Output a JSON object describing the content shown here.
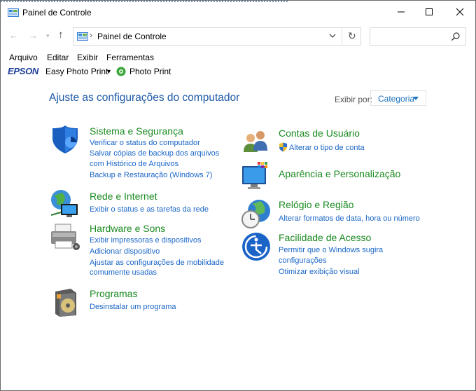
{
  "window": {
    "title": "Painel de Controle"
  },
  "address": {
    "path": "Painel de Controle",
    "search_placeholder": ""
  },
  "menu": [
    "Arquivo",
    "Editar",
    "Exibir",
    "Ferramentas"
  ],
  "epson": {
    "logo": "EPSON",
    "easy_photo_print": "Easy Photo Print",
    "photo_print": "Photo Print"
  },
  "main": {
    "title": "Ajuste as configurações do computador",
    "view_by_label": "Exibir por:",
    "view_by_value": "Categoria"
  },
  "categories": {
    "system": {
      "title": "Sistema e Segurança",
      "icon": "shield-icon",
      "links": [
        "Verificar o status do computador",
        "Salvar cópias de backup dos arquivos",
        "com Histórico de Arquivos",
        "Backup e Restauração (Windows 7)"
      ]
    },
    "network": {
      "title": "Rede e Internet",
      "icon": "network-globe-icon",
      "links": [
        "Exibir o status e as tarefas da rede"
      ]
    },
    "hardware": {
      "title": "Hardware e Sons",
      "icon": "printer-icon",
      "links": [
        "Exibir impressoras e dispositivos",
        "Adicionar dispositivo",
        "Ajustar as configurações de mobilidade",
        "comumente usadas"
      ]
    },
    "programs": {
      "title": "Programas",
      "icon": "programs-disc-icon",
      "links": [
        "Desinstalar um programa"
      ]
    },
    "users": {
      "title": "Contas de Usuário",
      "icon": "users-icon",
      "links": [
        "Alterar o tipo de conta"
      ]
    },
    "appearance": {
      "title": "Aparência e Personalização",
      "icon": "monitor-palette-icon",
      "links": []
    },
    "clock": {
      "title": "Relógio e Região",
      "icon": "clock-globe-icon",
      "links": [
        "Alterar formatos de data, hora ou número"
      ]
    },
    "access": {
      "title": "Facilidade de Acesso",
      "icon": "ease-of-access-icon",
      "links": [
        "Permitir que o Windows sugira",
        "configurações",
        "Otimizar exibição visual"
      ]
    }
  },
  "colors": {
    "heading_blue": "#1e5aa8",
    "link_blue": "#1a66c7",
    "category_green": "#1a8a1f",
    "epson_blue": "#1e3f9a"
  }
}
